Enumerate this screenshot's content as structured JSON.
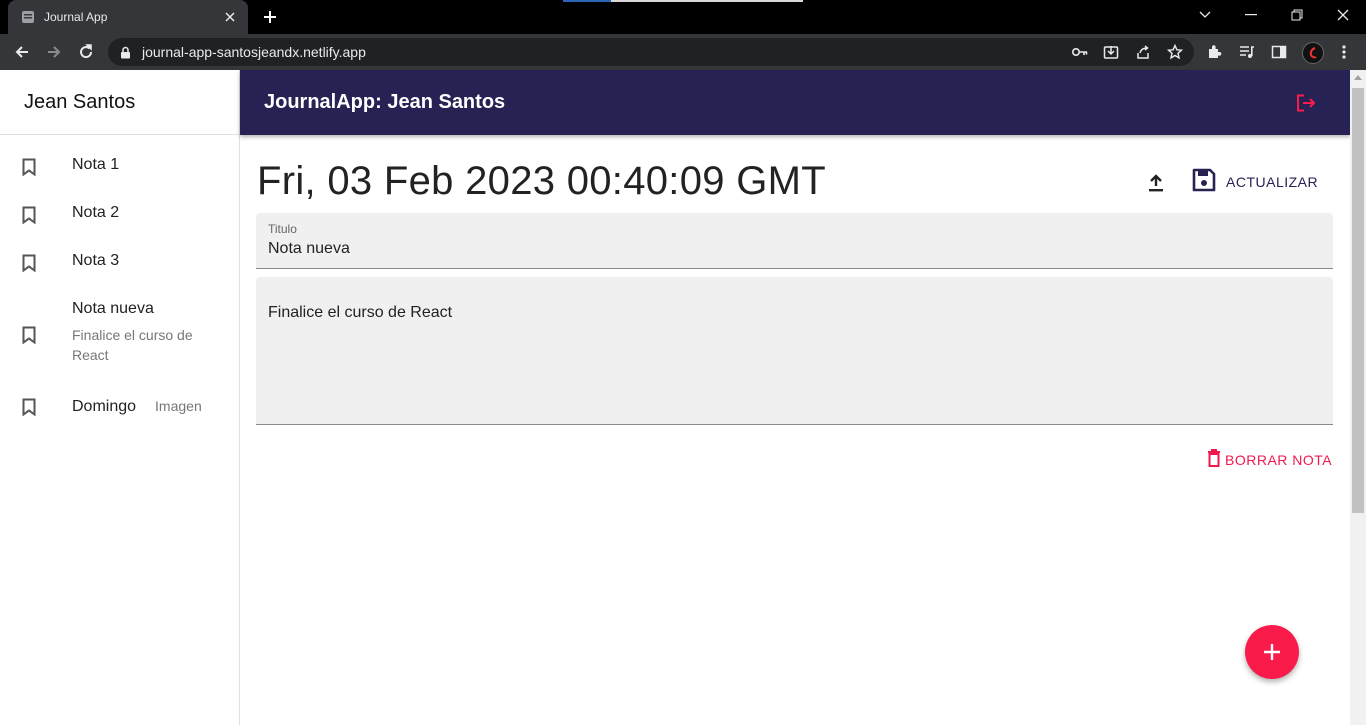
{
  "browser": {
    "tab_title": "Journal App",
    "url": "journal-app-santosjeandx.netlify.app",
    "icons": [
      "back-icon",
      "forward-icon",
      "reload-icon",
      "lock-icon",
      "key-icon",
      "install-icon",
      "share-icon",
      "star-icon",
      "extensions-icon",
      "media-icon",
      "side-panel-icon",
      "profile-avatar",
      "menu-icon"
    ]
  },
  "sidebar": {
    "user_name": "Jean Santos",
    "notes": [
      {
        "title": "Nota 1",
        "body": ""
      },
      {
        "title": "Nota 2",
        "body": ""
      },
      {
        "title": "Nota 3",
        "body": ""
      },
      {
        "title": "Nota nueva",
        "body": "Finalice el curso de React"
      },
      {
        "title": "Domingo",
        "body": "Imagen"
      }
    ]
  },
  "appbar": {
    "title": "JournalApp: Jean Santos"
  },
  "note": {
    "date": "Fri, 03 Feb 2023 00:40:09 GMT",
    "save_label": "ACTUALIZAR",
    "title_label": "Titulo",
    "title_value": "Nota nueva",
    "body_value": "Finalice el curso de React",
    "delete_label": "BORRAR NOTA"
  },
  "colors": {
    "primary": "#262254",
    "accent": "#f91c4a",
    "field_bg": "#f0f0f0"
  }
}
